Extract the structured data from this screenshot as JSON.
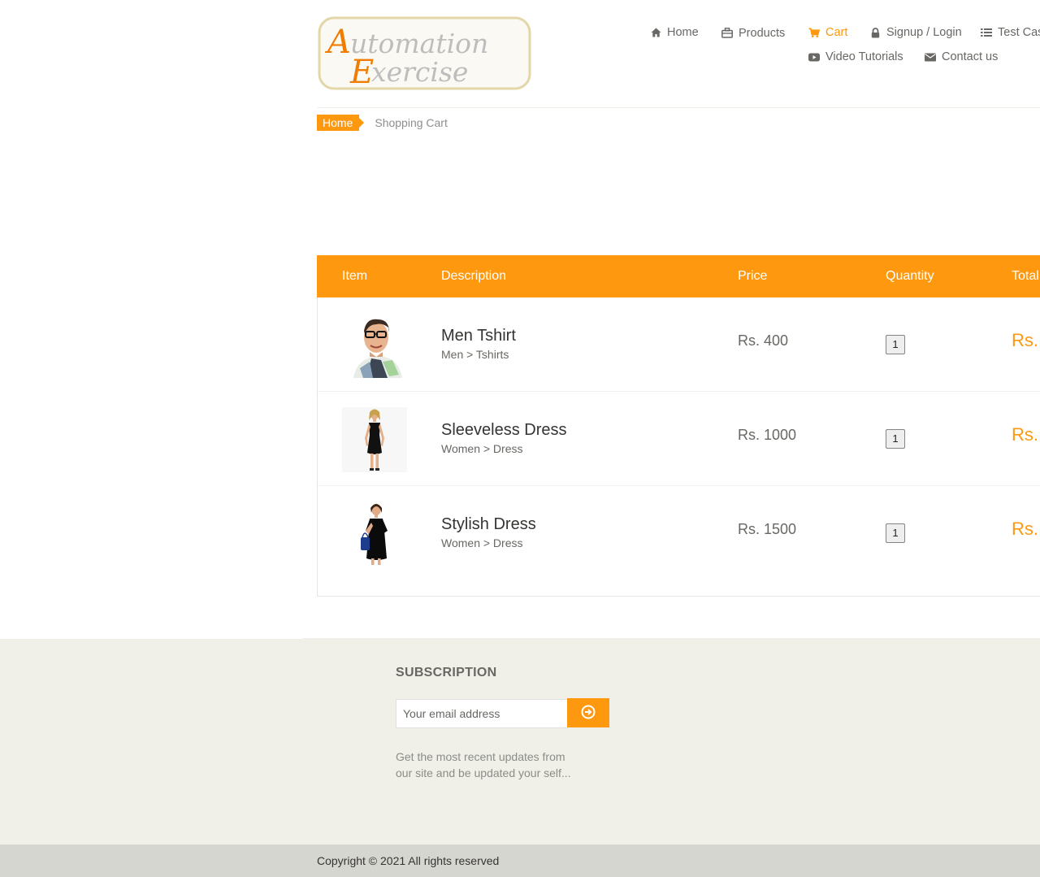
{
  "header": {
    "logo": {
      "line1": "Automation",
      "line2": "Exercise"
    },
    "nav": [
      {
        "label": "Home",
        "icon": "home-icon"
      },
      {
        "label": "Products",
        "icon": "products-icon"
      },
      {
        "label": "Cart",
        "icon": "cart-icon",
        "active": true
      },
      {
        "label": "Signup / Login",
        "icon": "lock-icon"
      },
      {
        "label": "Test Cas",
        "icon": "list-icon"
      },
      {
        "label": "Video Tutorials",
        "icon": "video-icon"
      },
      {
        "label": "Contact us",
        "icon": "envelope-icon"
      }
    ]
  },
  "breadcrumb": {
    "home": "Home",
    "current": "Shopping Cart"
  },
  "cart": {
    "columns": [
      "Item",
      "Description",
      "Price",
      "Quantity",
      "Total"
    ],
    "rows": [
      {
        "name": "Men Tshirt",
        "category": "Men > Tshirts",
        "price": "Rs. 400",
        "quantity": "1",
        "total": "Rs.",
        "image": "men-tshirt-image"
      },
      {
        "name": "Sleeveless Dress",
        "category": "Women > Dress",
        "price": "Rs. 1000",
        "quantity": "1",
        "total": "Rs.",
        "image": "sleeveless-dress-image"
      },
      {
        "name": "Stylish Dress",
        "category": "Women > Dress",
        "price": "Rs. 1500",
        "quantity": "1",
        "total": "Rs.",
        "image": "stylish-dress-image"
      }
    ]
  },
  "footer": {
    "subscription_title": "SUBSCRIPTION",
    "email_placeholder": "Your email address",
    "note": "Get the most recent updates from our site and be updated your self...",
    "copyright": "Copyright © 2021 All rights reserved"
  },
  "colors": {
    "accent": "#FE980F",
    "text": "#696763",
    "footer_bg": "#f0f0e9",
    "footer_bottom_bg": "#d6d6d0"
  }
}
